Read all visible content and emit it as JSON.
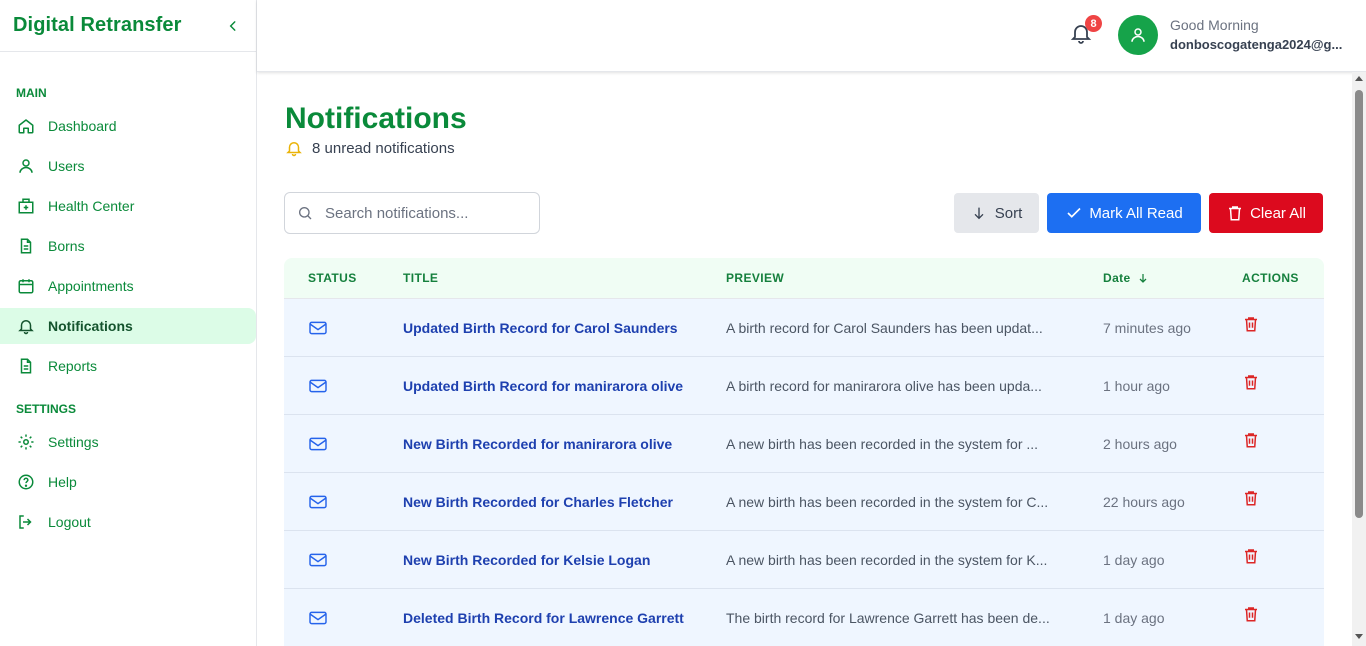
{
  "brand": {
    "title": "Digital Retransfer"
  },
  "sidebar": {
    "main_label": "MAIN",
    "settings_label": "SETTINGS",
    "main_items": [
      {
        "label": "Dashboard",
        "icon": "home-icon"
      },
      {
        "label": "Users",
        "icon": "user-icon"
      },
      {
        "label": "Health Center",
        "icon": "hospital-icon"
      },
      {
        "label": "Borns",
        "icon": "document-icon"
      },
      {
        "label": "Appointments",
        "icon": "calendar-icon"
      },
      {
        "label": "Notifications",
        "icon": "bell-icon",
        "active": true
      },
      {
        "label": "Reports",
        "icon": "report-icon"
      }
    ],
    "settings_items": [
      {
        "label": "Settings",
        "icon": "gear-icon"
      },
      {
        "label": "Help",
        "icon": "help-icon"
      },
      {
        "label": "Logout",
        "icon": "logout-icon"
      }
    ]
  },
  "header": {
    "notification_count": "8",
    "greeting": "Good Morning",
    "user_email": "donboscogatenga2024@g..."
  },
  "page": {
    "title": "Notifications",
    "unread_text": "8 unread notifications",
    "search_placeholder": "Search notifications...",
    "sort_label": "Sort",
    "mark_all_label": "Mark All Read",
    "clear_all_label": "Clear All"
  },
  "table": {
    "headers": {
      "status": "STATUS",
      "title": "TITLE",
      "preview": "PREVIEW",
      "date": "Date",
      "actions": "ACTIONS"
    },
    "rows": [
      {
        "title": "Updated Birth Record for Carol Saunders",
        "preview": "A birth record for Carol Saunders has been updat...",
        "date": "7 minutes ago"
      },
      {
        "title": "Updated Birth Record for manirarora olive",
        "preview": "A birth record for manirarora olive has been upda...",
        "date": "1 hour ago"
      },
      {
        "title": "New Birth Recorded for manirarora olive",
        "preview": "A new birth has been recorded in the system for ...",
        "date": "2 hours ago"
      },
      {
        "title": "New Birth Recorded for Charles Fletcher",
        "preview": "A new birth has been recorded in the system for C...",
        "date": "22 hours ago"
      },
      {
        "title": "New Birth Recorded for Kelsie Logan",
        "preview": "A new birth has been recorded in the system for K...",
        "date": "1 day ago"
      },
      {
        "title": "Deleted Birth Record for Lawrence Garrett",
        "preview": "The birth record for Lawrence Garrett has been de...",
        "date": "1 day ago"
      }
    ]
  },
  "colors": {
    "brand_green": "#0a8a3a",
    "active_bg": "#dcfce7",
    "row_bg": "#eff6ff",
    "title_blue": "#1e40af",
    "mark_all_blue": "#1d6ff2",
    "clear_red": "#dc0a1e"
  }
}
